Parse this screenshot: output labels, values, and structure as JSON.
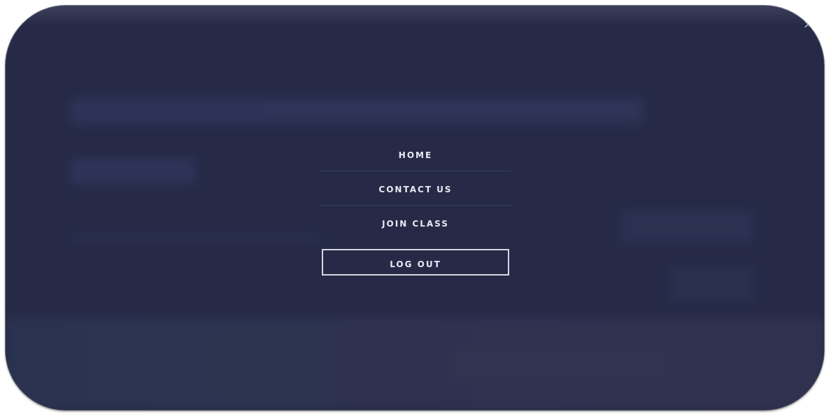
{
  "menu": {
    "items": [
      {
        "label": "HOME"
      },
      {
        "label": "CONTACT US"
      },
      {
        "label": "JOIN CLASS"
      }
    ],
    "logout_label": "LOG OUT"
  },
  "icons": {
    "close": "close-icon"
  },
  "colors": {
    "overlay_background": "#262a47",
    "menu_text": "#e8eaf2",
    "divider": "#3a3f5e",
    "button_border": "#d5d8e4"
  }
}
